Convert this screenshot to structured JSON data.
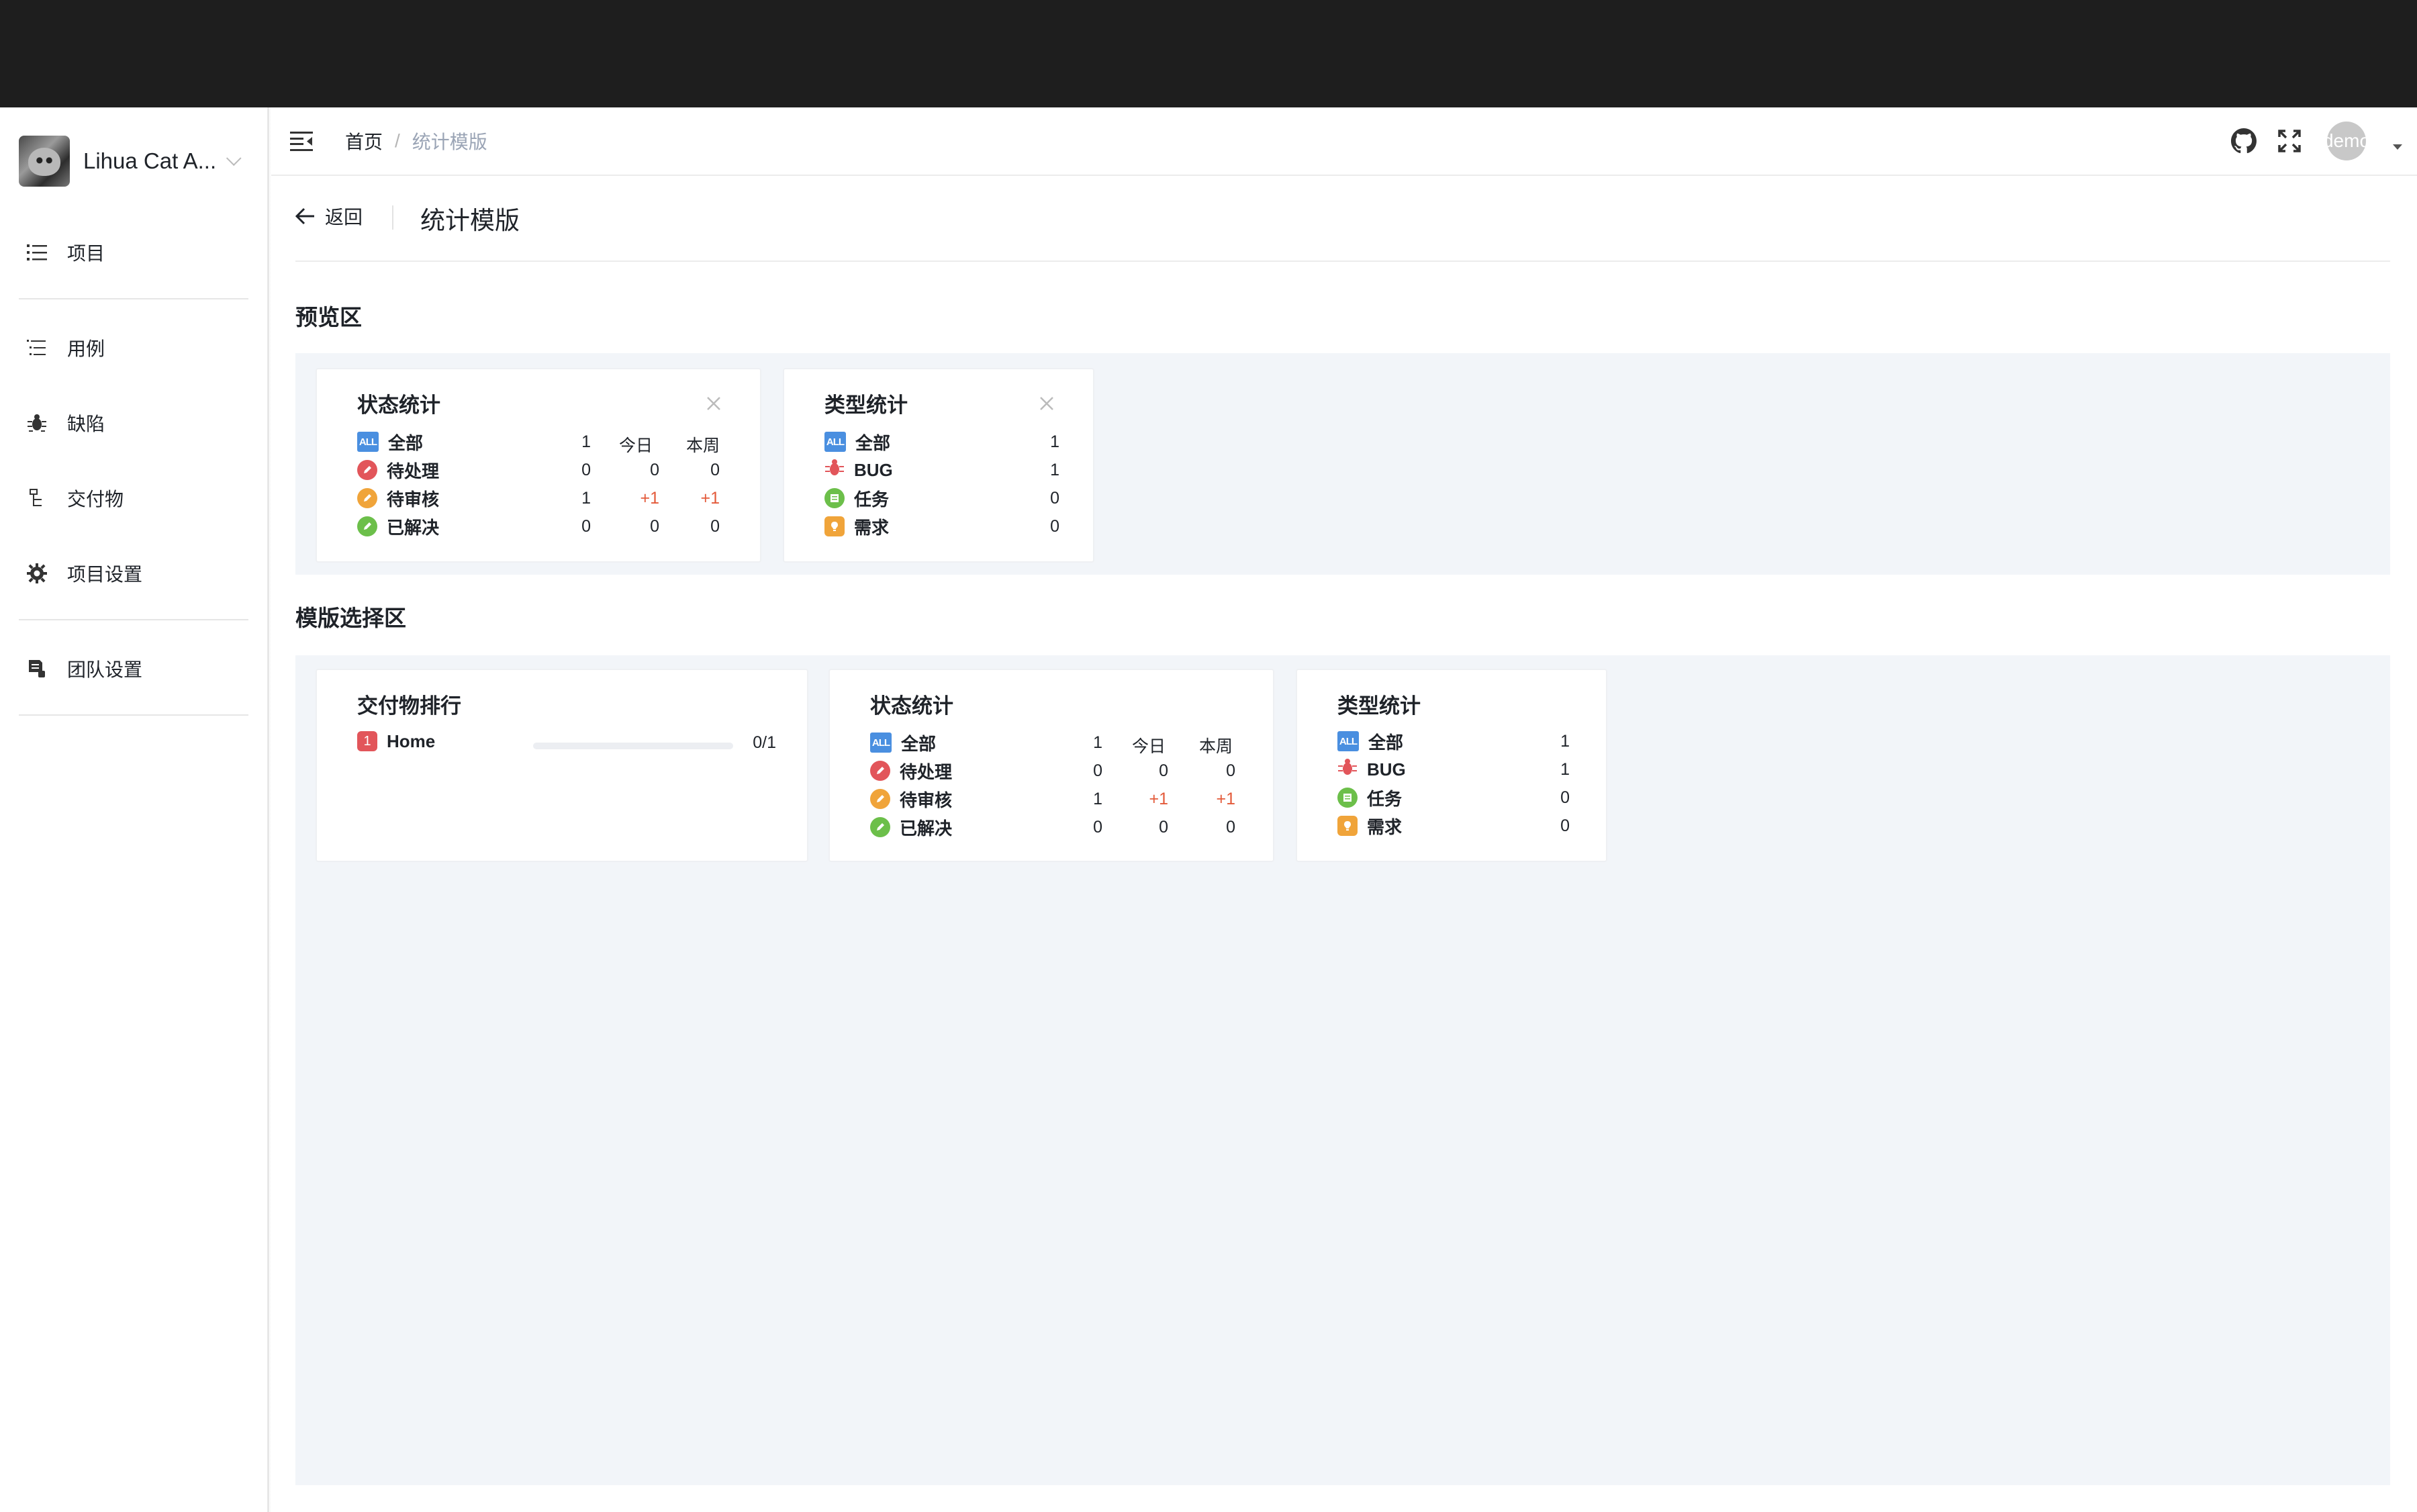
{
  "sidebar": {
    "team_name": "Lihua Cat A...",
    "items": [
      {
        "label": "项目",
        "icon": "list-icon"
      },
      {
        "label": "用例",
        "icon": "case-list-icon"
      },
      {
        "label": "缺陷",
        "icon": "bug-icon"
      },
      {
        "label": "交付物",
        "icon": "deliverable-icon"
      },
      {
        "label": "项目设置",
        "icon": "gear-icon"
      },
      {
        "label": "团队设置",
        "icon": "team-settings-icon"
      }
    ]
  },
  "header": {
    "breadcrumb": {
      "home": "首页",
      "separator": "/",
      "current": "统计模版"
    },
    "user_avatar_text": "demo"
  },
  "page": {
    "back_label": "返回",
    "title": "统计模版"
  },
  "preview": {
    "title": "预览区",
    "status_card": {
      "title": "状态统计",
      "columns": [
        "今日",
        "本周"
      ],
      "rows": [
        {
          "label": "全部",
          "total": "1",
          "today": "今日",
          "week": "本周"
        },
        {
          "label": "待处理",
          "total": "0",
          "today": "0",
          "week": "0"
        },
        {
          "label": "待审核",
          "total": "1",
          "today": "+1",
          "week": "+1"
        },
        {
          "label": "已解决",
          "total": "0",
          "today": "0",
          "week": "0"
        }
      ]
    },
    "type_card": {
      "title": "类型统计",
      "rows": [
        {
          "label": "全部",
          "value": "1"
        },
        {
          "label": "BUG",
          "value": "1"
        },
        {
          "label": "任务",
          "value": "0"
        },
        {
          "label": "需求",
          "value": "0"
        }
      ]
    }
  },
  "templates": {
    "title": "模版选择区",
    "ranking_card": {
      "title": "交付物排行",
      "items": [
        {
          "rank": "1",
          "name": "Home",
          "progress_text": "0/1",
          "progress": 0
        }
      ]
    },
    "status_card": {
      "title": "状态统计",
      "rows": [
        {
          "label": "全部",
          "total": "1",
          "today": "今日",
          "week": "本周"
        },
        {
          "label": "待处理",
          "total": "0",
          "today": "0",
          "week": "0"
        },
        {
          "label": "待审核",
          "total": "1",
          "today": "+1",
          "week": "+1"
        },
        {
          "label": "已解决",
          "total": "0",
          "today": "0",
          "week": "0"
        }
      ]
    },
    "type_card": {
      "title": "类型统计",
      "rows": [
        {
          "label": "全部",
          "value": "1"
        },
        {
          "label": "BUG",
          "value": "1"
        },
        {
          "label": "任务",
          "value": "0"
        },
        {
          "label": "需求",
          "value": "0"
        }
      ]
    }
  },
  "colors": {
    "accent_blue": "#4a8fe0",
    "pending_red": "#e2555a",
    "review_orange": "#f0a43a",
    "resolved_green": "#6cbf4a",
    "delta_red": "#e35a3a"
  }
}
